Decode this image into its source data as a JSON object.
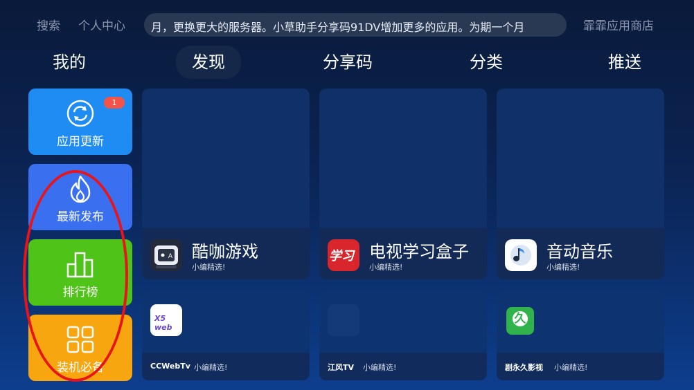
{
  "topbar": {
    "search": "搜索",
    "profile": "个人中心",
    "announcement": "月，更换更大的服务器。小草助手分享码91DV增加更多的应用。为期一个月",
    "store": "霏霏应用商店"
  },
  "tabs": [
    "我的",
    "发现",
    "分享码",
    "分类",
    "推送"
  ],
  "active_tab": "发现",
  "sidebar": {
    "update": {
      "label": "应用更新",
      "badge": "1",
      "icon": "refresh-icon"
    },
    "latest": {
      "label": "最新发布",
      "icon": "flame-icon"
    },
    "rank": {
      "label": "排行榜",
      "icon": "bar-chart-icon"
    },
    "essential": {
      "label": "装机必备",
      "icon": "grid-icon"
    }
  },
  "featured": [
    {
      "name": "酷咖游戏",
      "subtitle": "小编精选!",
      "icon": "kuka-game-icon"
    },
    {
      "name": "电视学习盒子",
      "subtitle": "小编精选!",
      "icon": "tv-study-box-icon",
      "icon_text": "学习"
    },
    {
      "name": "音动音乐",
      "subtitle": "小编精选!",
      "icon": "music-note-icon"
    }
  ],
  "apps": [
    {
      "name": "CCWebTv",
      "subtitle": "小编精选!",
      "icon": "x5-web-icon",
      "icon_text": "X5 web"
    },
    {
      "name": "江风TV",
      "subtitle": "小编精选!",
      "icon": "jiangfeng-tv-icon"
    },
    {
      "name": "剧永久影视",
      "subtitle": "小编精选!",
      "icon": "jiu-icon",
      "icon_text": "久"
    }
  ],
  "colors": {
    "update": "#1e8cf2",
    "latest": "#3a6ff0",
    "rank": "#4fc318",
    "essential": "#f7a60f",
    "badge": "#f2544a",
    "annotation": "#e8141b"
  }
}
